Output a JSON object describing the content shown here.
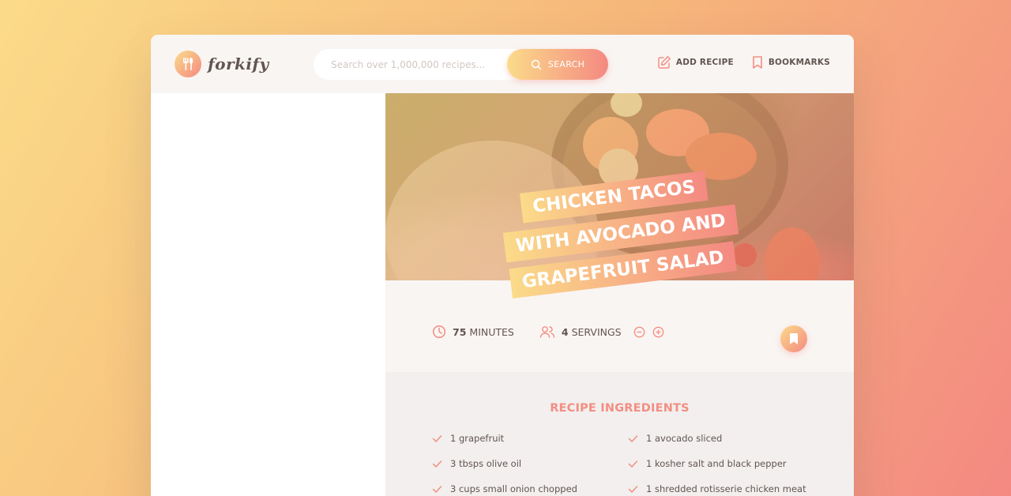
{
  "brand": {
    "name": "forkify"
  },
  "search": {
    "placeholder": "Search over 1,000,000 recipes...",
    "button_label": "SEARCH"
  },
  "nav": {
    "add_recipe": "ADD RECIPE",
    "bookmarks": "BOOKMARKS"
  },
  "recipe": {
    "title": "Chicken Tacos with Avocado and Grapefruit Salad",
    "cooking_time": "75",
    "cooking_time_unit": "minutes",
    "servings": "4",
    "servings_unit": "servings"
  },
  "ingredients": {
    "heading": "Recipe ingredients",
    "items": [
      "1 grapefruit",
      "1 avocado sliced",
      "3 tbsps olive oil",
      "1 kosher salt and black pepper",
      "3 cups small onion chopped",
      "1 shredded rotisserie chicken meat"
    ]
  },
  "colors": {
    "accent_start": "#fbdb89",
    "accent_end": "#f48982",
    "text": "#615551"
  }
}
